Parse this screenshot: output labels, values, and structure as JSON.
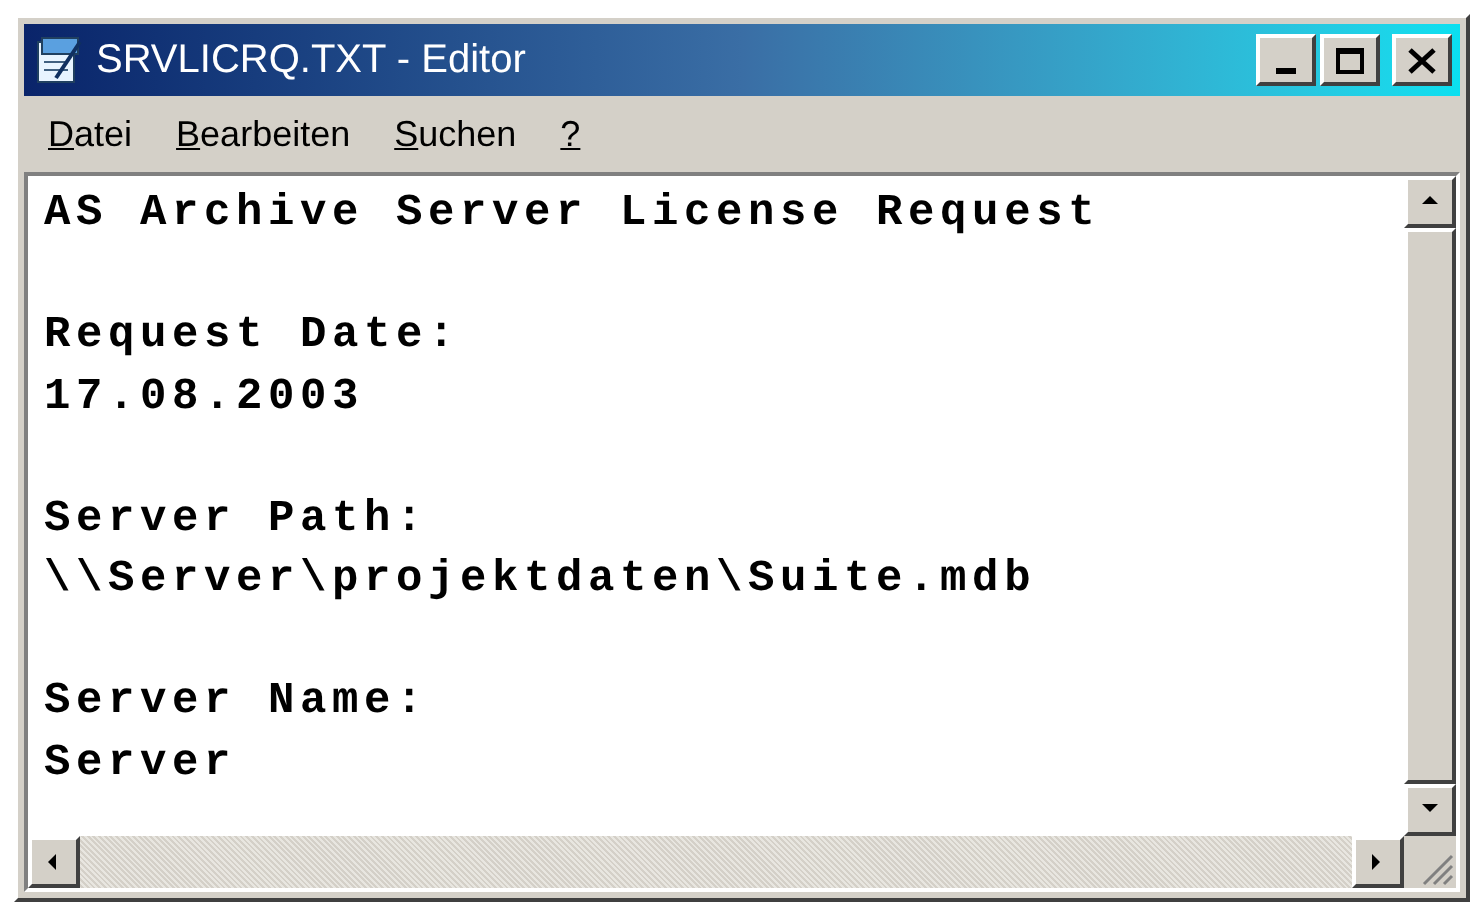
{
  "window": {
    "title": "SRVLICRQ.TXT - Editor"
  },
  "menu": [
    {
      "label": "Datei"
    },
    {
      "label": "Bearbeiten"
    },
    {
      "label": "Suchen"
    },
    {
      "label": "?"
    }
  ],
  "document": {
    "heading": "AS Archive Server License Request",
    "fields": [
      {
        "label": "Request Date:",
        "value": "17.08.2003"
      },
      {
        "label": "Server Path:",
        "value": "\\\\Server\\projektdaten\\Suite.mdb"
      },
      {
        "label": "Server Name:",
        "value": "Server"
      }
    ]
  }
}
